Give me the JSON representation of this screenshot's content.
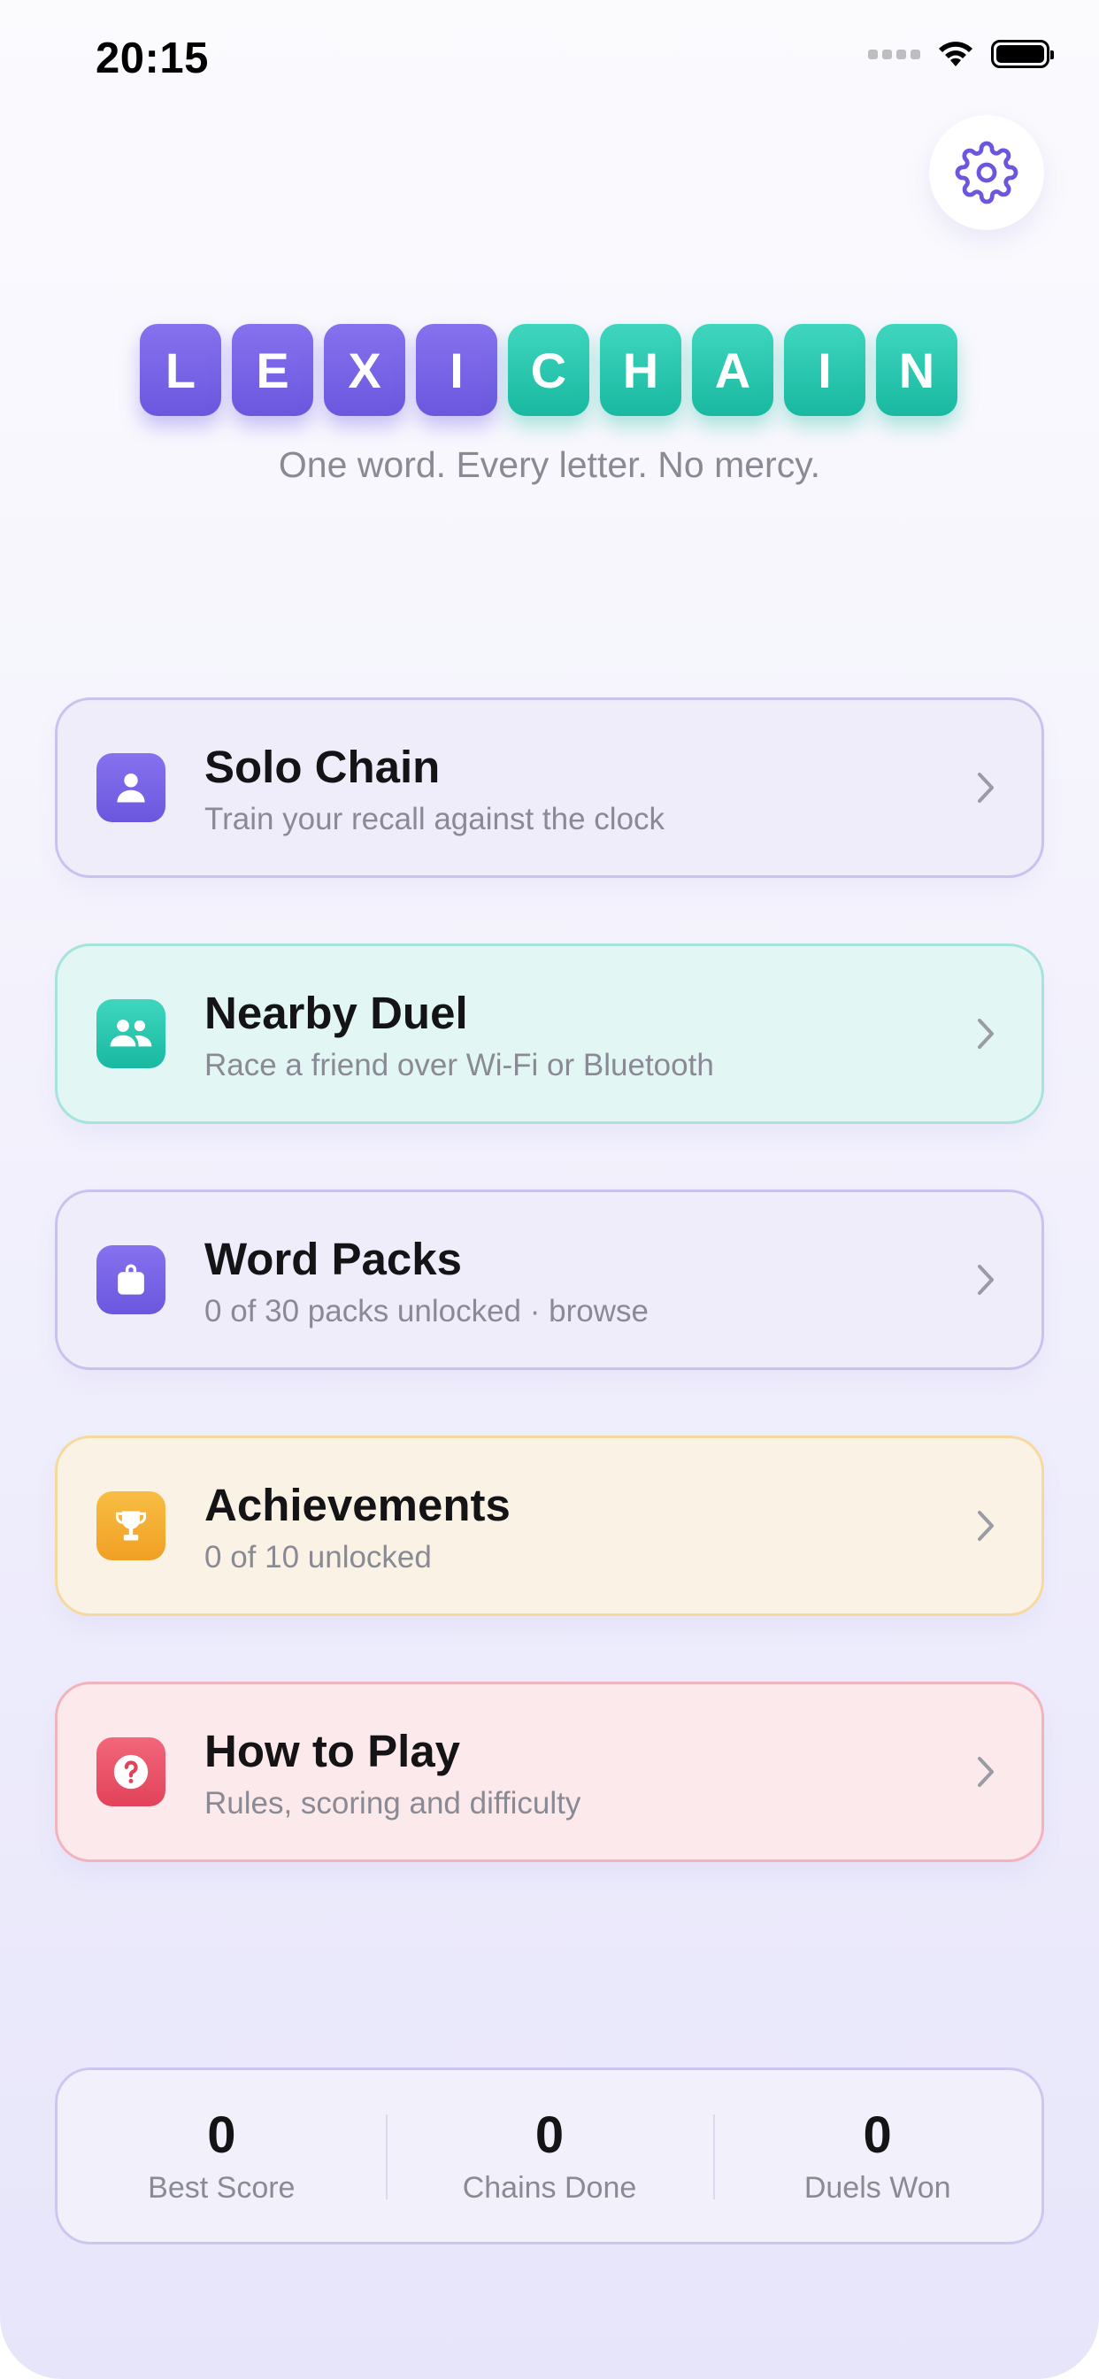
{
  "status_bar": {
    "time": "20:15"
  },
  "settings": {
    "icon": "gear-icon"
  },
  "logo": {
    "letters": [
      {
        "char": "L",
        "color": "#7563e6"
      },
      {
        "char": "E",
        "color": "#7563e6"
      },
      {
        "char": "X",
        "color": "#7563e6"
      },
      {
        "char": "I",
        "color": "#7563e6"
      },
      {
        "char": "C",
        "color": "#2cc7af"
      },
      {
        "char": "H",
        "color": "#2cc7af"
      },
      {
        "char": "A",
        "color": "#2cc7af"
      },
      {
        "char": "I",
        "color": "#2cc7af"
      },
      {
        "char": "N",
        "color": "#2cc7af"
      }
    ],
    "tagline": "One word. Every letter. No mercy."
  },
  "menu": [
    {
      "title": "Solo Chain",
      "subtitle": "Train your recall against the clock",
      "icon": "person-icon",
      "accent": "#7563e6"
    },
    {
      "title": "Nearby Duel",
      "subtitle": "Race a friend over Wi-Fi or Bluetooth",
      "icon": "two-people-icon",
      "accent": "#2cc7af"
    },
    {
      "title": "Word Packs",
      "subtitle": "0 of 30 packs unlocked · browse",
      "icon": "bag-icon",
      "accent": "#7563e6"
    },
    {
      "title": "Achievements",
      "subtitle": "0 of 10 unlocked",
      "icon": "trophy-icon",
      "accent": "#f4ae33"
    },
    {
      "title": "How to Play",
      "subtitle": "Rules, scoring and difficulty",
      "icon": "question-icon",
      "accent": "#ea5168"
    }
  ],
  "stats": [
    {
      "value": "0",
      "label": "Best Score"
    },
    {
      "value": "0",
      "label": "Chains Done"
    },
    {
      "value": "0",
      "label": "Duels Won"
    }
  ]
}
